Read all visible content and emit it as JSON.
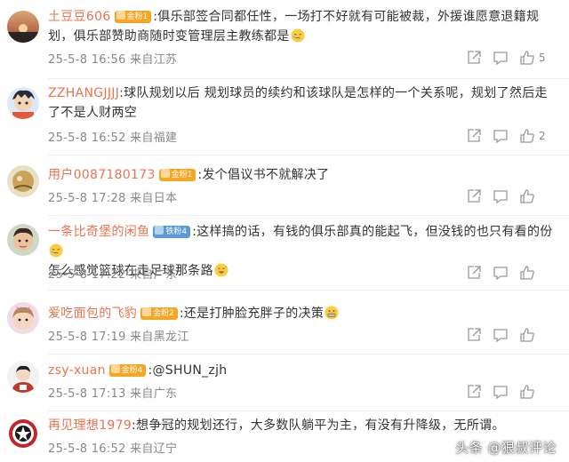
{
  "comments": [
    {
      "username": "土豆豆606",
      "badge": "金粉1",
      "text": ":俱乐部签合同都任性，一场打不好就有可能被裁，外援谁愿意退籍规划，俱乐部赞助商随时变管理层主教练都是",
      "emoji": "pensive-face-emoji",
      "date": "25-5-8",
      "time": "16:56",
      "location": "来自江苏",
      "likes": "5"
    },
    {
      "username": "ZZHANGJJJJ",
      "badge": "",
      "text": ":球队规划以后 规划球员的续约和该球队是怎样的一个关系呢，规划了然后走了不是人财两空",
      "emoji": "",
      "date": "25-5-8",
      "time": "16:52",
      "location": "来自福建",
      "likes": "2"
    },
    {
      "username": "用户0087180173",
      "badge": "金粉1",
      "text": ":发个倡议书不就解决了",
      "emoji": "",
      "date": "25-5-8",
      "time": "17:28",
      "location": "来自日本",
      "likes": ""
    },
    {
      "username": "一条比奇堡的闲鱼",
      "badge": "铁粉4",
      "text": ":这样搞的话，有钱的俱乐部真的能起飞，但没钱的也只有看的份",
      "emoji": "pensive-face-emoji",
      "text2": "怎么感觉篮球在走足球那条路",
      "emoji2": "sweat-smile-emoji",
      "date": "25-5-8",
      "time": "17:22",
      "location": "来自广东",
      "likes": ""
    },
    {
      "username": "爱吃面包的飞豹",
      "badge": "金粉2",
      "text": ":还是打肿脸充胖子的决策",
      "emoji": "grimace-emoji",
      "date": "25-5-8",
      "time": "17:19",
      "location": "来自黑龙江",
      "likes": ""
    },
    {
      "username": "zsy-xuan",
      "badge": "金粉4",
      "text": ":@SHUN_zjh",
      "emoji": "",
      "date": "25-5-8",
      "time": "17:13",
      "location": "来自广东",
      "likes": ""
    },
    {
      "username": "再见理想1979",
      "badge": "",
      "text": ":想争冠的规划还行，大多数队躺平为主，有没有升降级，无所谓。",
      "emoji": "",
      "date": "25-5-8",
      "time": "16:52",
      "location": "来自辽宁",
      "likes": ""
    }
  ],
  "watermark": "头条 @狠叔评论",
  "colors": {
    "username": "#eb7350",
    "badge_gold": "#f5a623",
    "badge_blue": "#5b9bd5",
    "meta": "#888888"
  },
  "icons": {
    "share": "share-icon",
    "reply": "comment-icon",
    "like": "thumbs-up-icon"
  }
}
